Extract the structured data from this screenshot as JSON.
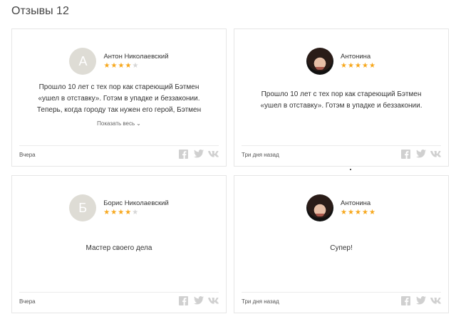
{
  "page": {
    "title": "Отзывы 12"
  },
  "colors": {
    "star_on": "#f7a71b",
    "star_off": "#d6d6d6",
    "social": "#d0d0d0"
  },
  "reviews": [
    {
      "avatar_type": "letter",
      "avatar_letter": "А",
      "name": "Антон Николаевский",
      "rating": 4,
      "text_lines": [
        "Прошло 10 лет с тех пор как стареющий Бэтмен",
        "«ушел в отставку». Готэм в упадке и беззаконии.",
        "Теперь, когда городу так нужен его герой, Бэтмен"
      ],
      "more_label": "Показать весь",
      "date": "Вчера"
    },
    {
      "avatar_type": "photo",
      "avatar_letter": "",
      "name": "Антонина",
      "rating": 5,
      "text_lines": [
        "Прошло 10 лет с тех пор как стареющий Бэтмен",
        "«ушел в отставку». Готэм в упадке и беззаконии."
      ],
      "more_label": "",
      "date": "Три дня назад"
    },
    {
      "avatar_type": "letter",
      "avatar_letter": "Б",
      "name": "Борис Николаевский",
      "rating": 4,
      "text_lines": [
        "Мастер своего дела"
      ],
      "more_label": "",
      "date": "Вчера"
    },
    {
      "avatar_type": "photo",
      "avatar_letter": "",
      "name": "Антонина",
      "rating": 5,
      "text_lines": [
        "Супер!"
      ],
      "more_label": "",
      "date": "Три дня назад"
    }
  ],
  "social_icons": [
    "facebook-icon",
    "twitter-icon",
    "vk-icon"
  ]
}
